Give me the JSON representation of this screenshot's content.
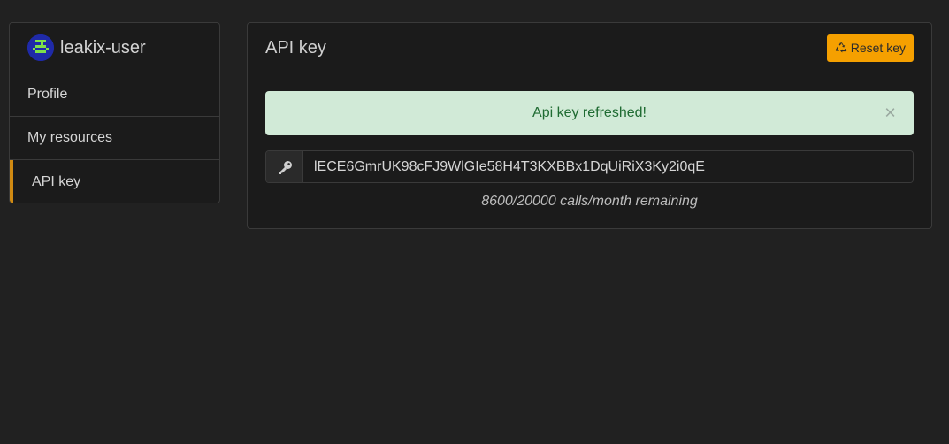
{
  "sidebar": {
    "username": "leakix-user",
    "items": [
      {
        "label": "Profile"
      },
      {
        "label": "My resources"
      },
      {
        "label": "API key",
        "active": true
      }
    ]
  },
  "main": {
    "title": "API key",
    "reset_label": "Reset key",
    "alert": {
      "message": "Api key refreshed!",
      "close_glyph": "×"
    },
    "api_key": "lECE6GmrUK98cFJ9WlGIe58H4T3KXBBx1DqUiRiX3Ky2i0qE",
    "remaining": "8600/20000 calls/month remaining"
  },
  "colors": {
    "background": "#212121",
    "accent": "#f5a000",
    "active_indicator": "#d08a12",
    "alert_bg": "#d1ead7",
    "alert_text": "#1f6b32"
  },
  "icons": {
    "avatar": "avatar-identicon",
    "reset": "recycle-icon",
    "key": "key-icon",
    "close": "close-icon"
  }
}
